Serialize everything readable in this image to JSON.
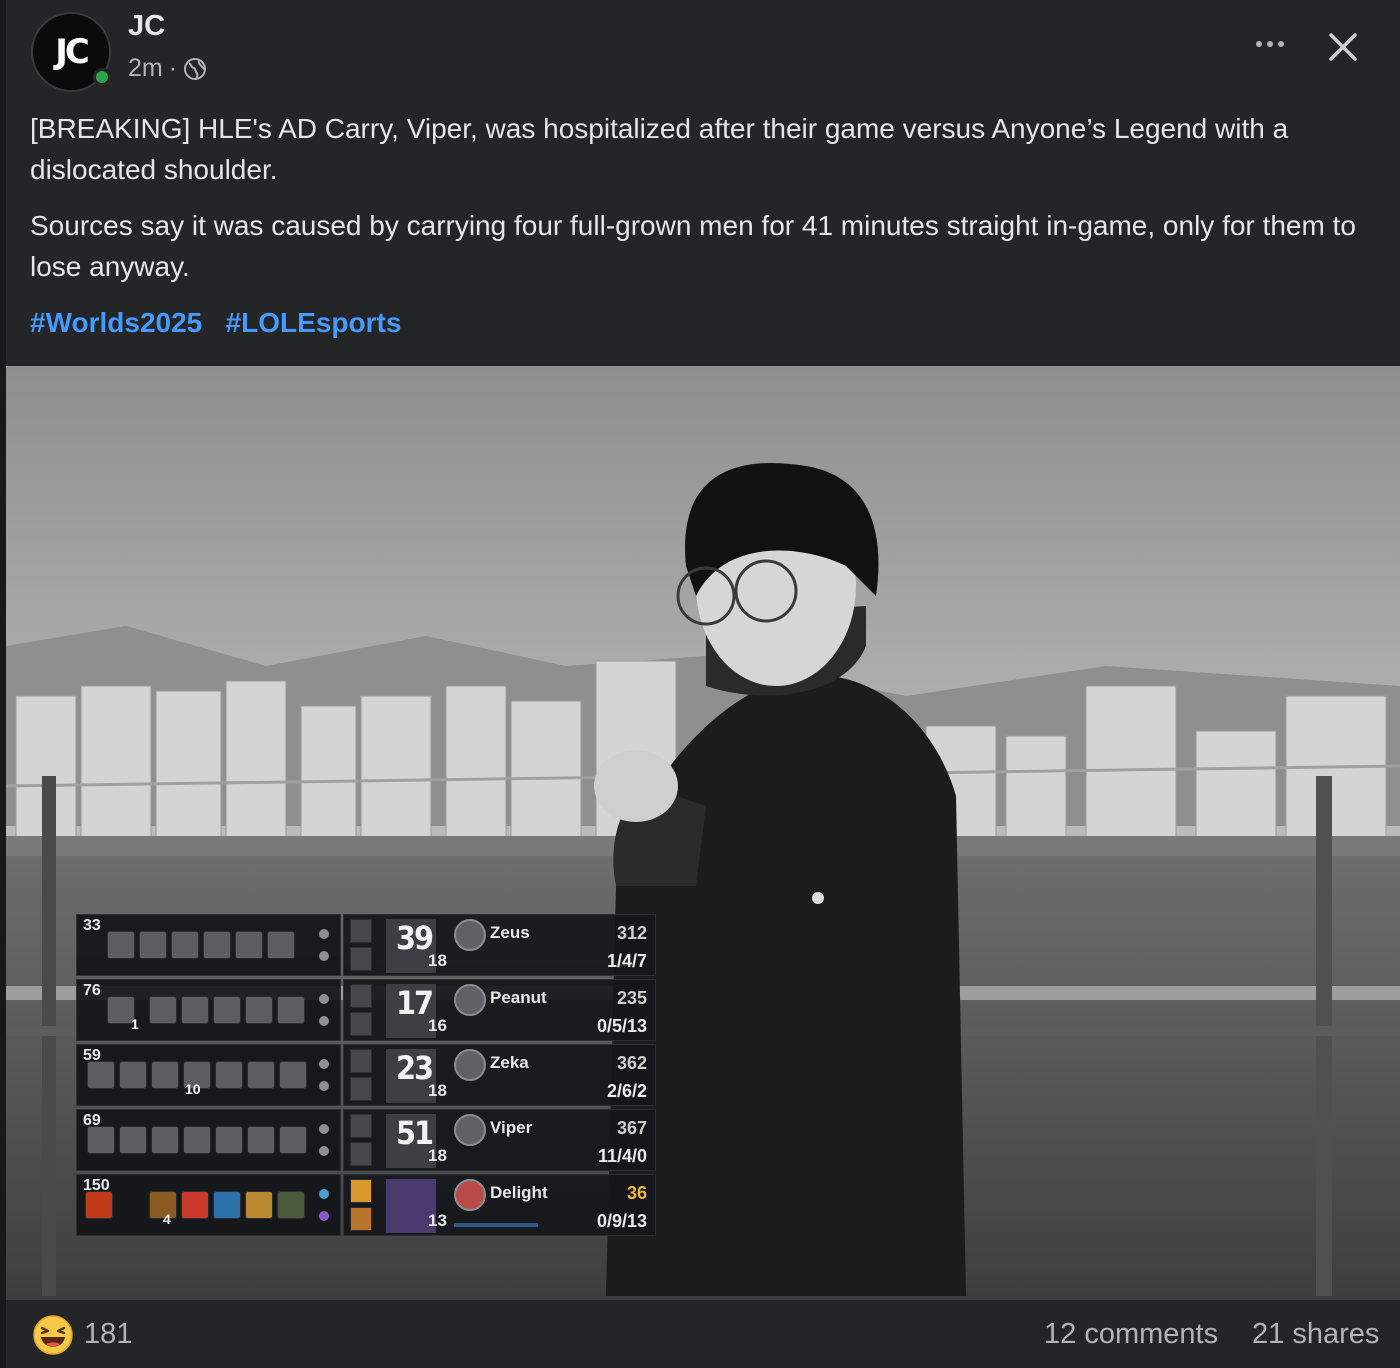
{
  "post": {
    "author": "JC",
    "avatar_text": "JC",
    "time": "2m",
    "separator": "·",
    "audience_icon": "globe-icon",
    "menu_icon": "more-horizontal-icon",
    "close_icon": "close-icon",
    "paragraphs": [
      "[BREAKING] HLE's AD Carry, Viper, was hospitalized after their game versus Anyone’s Legend with a dislocated shoulder.",
      "Sources say it was caused by carrying four full-grown men for 41 minutes straight in-game, only for them to lose anyway."
    ],
    "hashtags": [
      "#Worlds2025",
      "#LOLEsports"
    ]
  },
  "scoreboard": {
    "rows": [
      {
        "cs": "33",
        "item_count": "",
        "champ_level": "39",
        "player_level": "18",
        "name": "Zeus",
        "gold": "312",
        "kda": "1/4/7"
      },
      {
        "cs": "76",
        "item_count": "1",
        "champ_level": "17",
        "player_level": "16",
        "name": "Peanut",
        "gold": "235",
        "kda": "0/5/13"
      },
      {
        "cs": "59",
        "item_count": "10",
        "champ_level": "23",
        "player_level": "18",
        "name": "Zeka",
        "gold": "362",
        "kda": "2/6/2"
      },
      {
        "cs": "69",
        "item_count": "",
        "champ_level": "51",
        "player_level": "18",
        "name": "Viper",
        "gold": "367",
        "kda": "11/4/0"
      },
      {
        "cs": "150",
        "item_count": "4",
        "champ_level": "",
        "player_level": "13",
        "name": "Delight",
        "gold": "36",
        "kda": "0/9/13"
      }
    ]
  },
  "footer": {
    "reaction_icon": "haha-reaction-icon",
    "reaction_count": "181",
    "comments": "12 comments",
    "shares": "21 shares"
  },
  "colors": {
    "card_bg": "#242526",
    "text": "#e4e6eb",
    "secondary_text": "#b0b3b8",
    "hashtag": "#4599ff",
    "online": "#31a24c",
    "delight_gold": "#f0b93a"
  }
}
